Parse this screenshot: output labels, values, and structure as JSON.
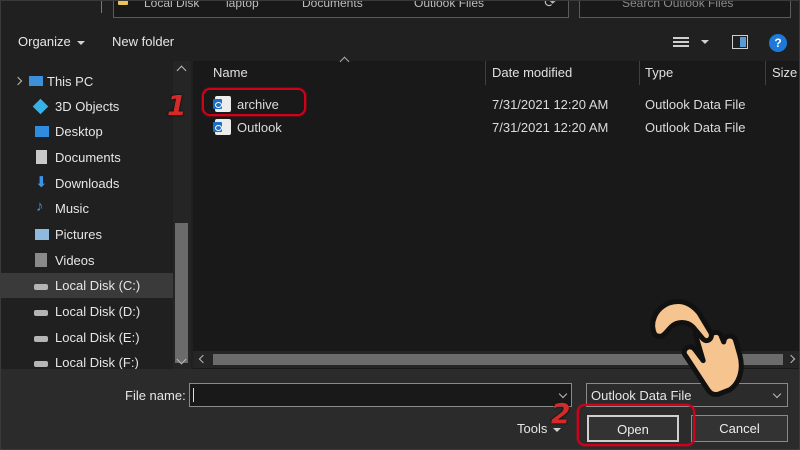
{
  "address": {
    "crumbs": [
      "Local Disk",
      "laptop",
      "Documents",
      "Outlook Files"
    ]
  },
  "search": {
    "placeholder": "Search Outlook Files"
  },
  "toolbar": {
    "organize": "Organize",
    "new_folder": "New folder",
    "help": "?"
  },
  "nav": {
    "items": [
      {
        "label": "This PC",
        "icon": "pc-icon"
      },
      {
        "label": "3D Objects",
        "icon": "cube-icon"
      },
      {
        "label": "Desktop",
        "icon": "desktop-icon"
      },
      {
        "label": "Documents",
        "icon": "document-icon"
      },
      {
        "label": "Downloads",
        "icon": "download-icon"
      },
      {
        "label": "Music",
        "icon": "music-icon"
      },
      {
        "label": "Pictures",
        "icon": "picture-icon"
      },
      {
        "label": "Videos",
        "icon": "video-icon"
      },
      {
        "label": "Local Disk (C:)",
        "icon": "drive-icon",
        "selected": true
      },
      {
        "label": "Local Disk (D:)",
        "icon": "drive-icon"
      },
      {
        "label": "Local Disk (E:)",
        "icon": "drive-icon"
      },
      {
        "label": "Local Disk (F:)",
        "icon": "drive-icon"
      }
    ]
  },
  "list": {
    "columns": [
      "Name",
      "Date modified",
      "Type",
      "Size"
    ],
    "rows": [
      {
        "name": "archive",
        "date": "7/31/2021 12:20 AM",
        "type": "Outlook Data File"
      },
      {
        "name": "Outlook",
        "date": "7/31/2021 12:20 AM",
        "type": "Outlook Data File"
      }
    ]
  },
  "bottom": {
    "file_name_label": "File name:",
    "file_name_value": "",
    "type_value": "Outlook Data File",
    "tools": "Tools",
    "open": "Open",
    "cancel": "Cancel"
  },
  "annotations": {
    "step1": "1",
    "step2": "2",
    "color": "#d0021b"
  }
}
